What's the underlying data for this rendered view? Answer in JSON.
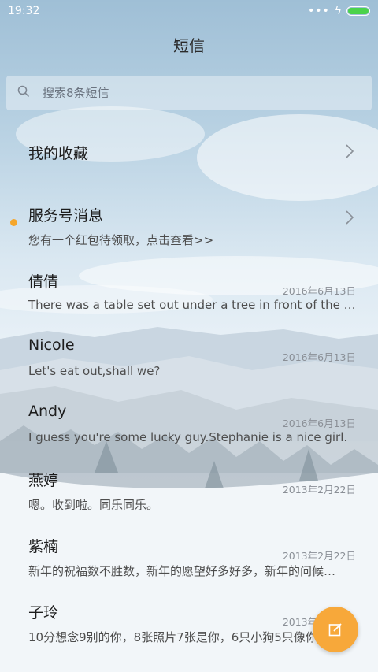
{
  "status_bar": {
    "time": "19:32",
    "signal_dots": "•••",
    "charging": "ϟ"
  },
  "header": {
    "title": "短信"
  },
  "search": {
    "placeholder": "搜索8条短信"
  },
  "conversations": [
    {
      "name": "我的收藏",
      "preview": "",
      "date": "",
      "chevron": true,
      "unread": false
    },
    {
      "name": "服务号消息",
      "preview": "您有一个红包待领取，点击查看>>",
      "date": "",
      "chevron": true,
      "unread": true
    },
    {
      "name": "倩倩",
      "preview": "There was a table set out under a tree in front of the ho…",
      "date": "2016年6月13日",
      "chevron": false,
      "unread": false
    },
    {
      "name": "Nicole",
      "preview": "Let's eat out,shall we?",
      "date": "2016年6月13日",
      "chevron": false,
      "unread": false
    },
    {
      "name": "Andy",
      "preview": "I guess you're some lucky guy.Stephanie is a nice girl.",
      "date": "2016年6月13日",
      "chevron": false,
      "unread": false
    },
    {
      "name": "燕婷",
      "preview": "嗯。收到啦。同乐同乐。",
      "date": "2013年2月22日",
      "chevron": false,
      "unread": false
    },
    {
      "name": "紫楠",
      "preview": "新年的祝福数不胜数，新年的愿望好多好多，新年的问候…",
      "date": "2013年2月22日",
      "chevron": false,
      "unread": false
    },
    {
      "name": "子玲",
      "preview": "10分想念9别的你，8张照片7张是你，6只小狗5只像你…",
      "date": "2013年2月22日",
      "chevron": false,
      "unread": false
    }
  ],
  "colors": {
    "accent": "#f7a83a",
    "unread_dot": "#f5a62b",
    "battery": "#4bd34b"
  },
  "icons": {
    "search": "search-icon",
    "compose": "compose-icon",
    "chevron": "chevron-right-icon"
  }
}
